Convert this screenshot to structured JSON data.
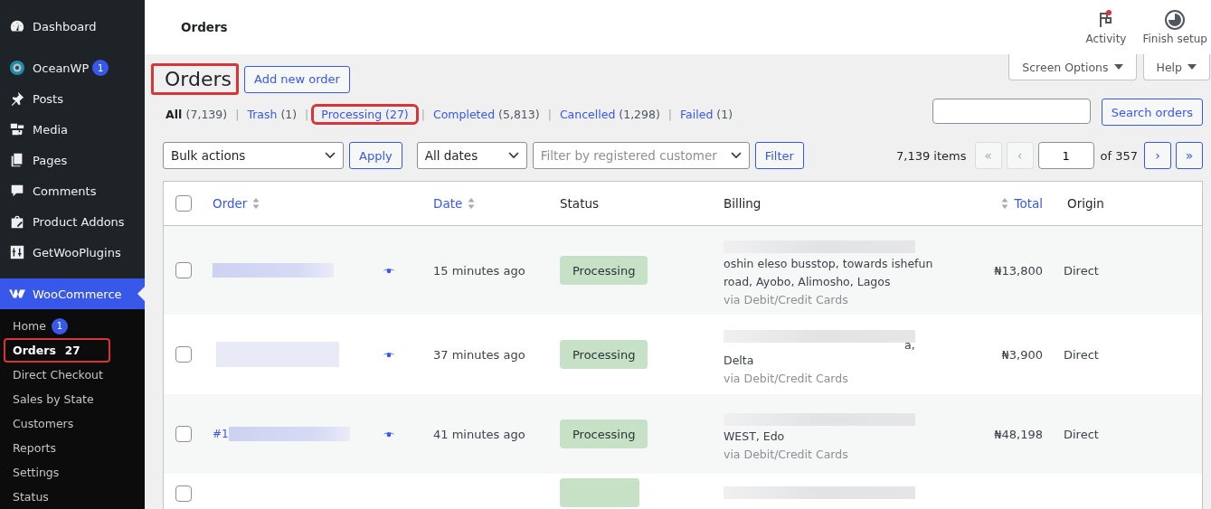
{
  "sidebar": {
    "items": [
      {
        "label": "Dashboard",
        "selected": false
      },
      {
        "label": "OceanWP",
        "badge": "1",
        "selected": false
      },
      {
        "label": "Posts",
        "selected": false
      },
      {
        "label": "Media",
        "selected": false
      },
      {
        "label": "Pages",
        "selected": false
      },
      {
        "label": "Comments",
        "selected": false
      },
      {
        "label": "Product Addons",
        "selected": false
      },
      {
        "label": "GetWooPlugins",
        "selected": false
      },
      {
        "label": "WooCommerce",
        "selected": true
      }
    ],
    "submenu": [
      {
        "label": "Home",
        "badge": "1",
        "selected": false,
        "highlighted": false
      },
      {
        "label": "Orders",
        "count": "27",
        "selected": true,
        "highlighted": true
      },
      {
        "label": "Direct Checkout",
        "selected": false,
        "highlighted": false
      },
      {
        "label": "Sales by State",
        "selected": false,
        "highlighted": false
      },
      {
        "label": "Customers",
        "selected": false,
        "highlighted": false
      },
      {
        "label": "Reports",
        "selected": false,
        "highlighted": false
      },
      {
        "label": "Settings",
        "selected": false,
        "highlighted": false
      },
      {
        "label": "Status",
        "selected": false,
        "highlighted": false
      }
    ]
  },
  "topbar": {
    "title": "Orders",
    "actions": [
      {
        "label": "Activity",
        "notification": true
      },
      {
        "label": "Finish setup",
        "notification": false
      }
    ]
  },
  "screen_options": "Screen Options",
  "help": "Help",
  "heading": {
    "title": "Orders",
    "highlighted": true,
    "add_button": "Add new order"
  },
  "filter_separator": "|",
  "status_filters": [
    {
      "label": "All",
      "count": "(7,139)",
      "selected": true,
      "highlighted": false
    },
    {
      "label": "Trash",
      "count": "(1)",
      "selected": false,
      "highlighted": false
    },
    {
      "label": "Processing",
      "count": "(27)",
      "selected": false,
      "highlighted": true
    },
    {
      "label": "Completed",
      "count": "(5,813)",
      "selected": false,
      "highlighted": false
    },
    {
      "label": "Cancelled",
      "count": "(1,298)",
      "selected": false,
      "highlighted": false
    },
    {
      "label": "Failed",
      "count": "(1)",
      "selected": false,
      "highlighted": false
    }
  ],
  "search": {
    "button": "Search orders"
  },
  "toolbar": {
    "bulk_actions": "Bulk actions",
    "apply": "Apply",
    "dates": "All dates",
    "customer_placeholder": "Filter by registered customer",
    "filter": "Filter"
  },
  "pagination": {
    "items": "7,139 items",
    "first": "«",
    "prev": "‹",
    "page": "1",
    "of": "of 357",
    "next": "›",
    "last": "»"
  },
  "table": {
    "select_all_checked": false,
    "columns": [
      {
        "label": "Order",
        "sortable": true
      },
      {
        "label": "Date",
        "sortable": true
      },
      {
        "label": "Status",
        "sortable": false
      },
      {
        "label": "Billing",
        "sortable": false
      },
      {
        "label": "Total",
        "sortable": true
      },
      {
        "label": "Origin",
        "sortable": false
      }
    ],
    "rows": [
      {
        "checked": false,
        "date": "15 minutes ago",
        "status": "Processing",
        "billing": [
          "oshin eleso busstop, towards ishefun",
          "road, Ayobo, Alimosho, Lagos"
        ],
        "payment": "via Debit/Credit Cards",
        "total": "₦13,800",
        "origin": "Direct"
      },
      {
        "checked": false,
        "date": "37 minutes ago",
        "status": "Processing",
        "billing": [
          "Delta"
        ],
        "billing_tail": "a,",
        "payment": "via Debit/Credit Cards",
        "total": "₦3,900",
        "origin": "Direct"
      },
      {
        "checked": false,
        "order": "#1",
        "date": "41 minutes ago",
        "status": "Processing",
        "billing": [
          "WEST, Edo"
        ],
        "payment": "via Debit/Credit Cards",
        "total": "₦48,198",
        "origin": "Direct"
      },
      {
        "checked": false
      }
    ]
  }
}
